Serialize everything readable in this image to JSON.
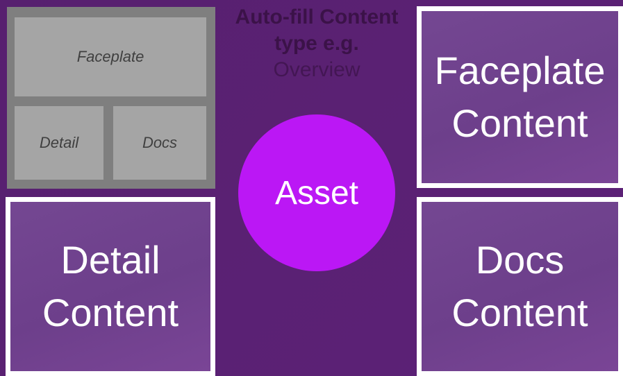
{
  "thumbnail": {
    "faceplate_label": "Faceplate",
    "detail_label": "Detail",
    "docs_label": "Docs"
  },
  "caption": {
    "line1": "Auto-fill Content",
    "line2": "type e.g.",
    "line3": "Overview"
  },
  "tiles": {
    "faceplate": {
      "line1": "Faceplate",
      "line2": "Content"
    },
    "detail": {
      "line1": "Detail",
      "line2": "Content"
    },
    "docs": {
      "line1": "Docs",
      "line2": "Content"
    }
  },
  "center": {
    "label": "Asset"
  },
  "colors": {
    "background": "#5a2173",
    "tile_fill": "#744792",
    "tile_border": "#ffffff",
    "asset_circle": "#bb17f5",
    "thumb_frame": "#7f7f7f",
    "thumb_cell": "#a5a5a5"
  }
}
